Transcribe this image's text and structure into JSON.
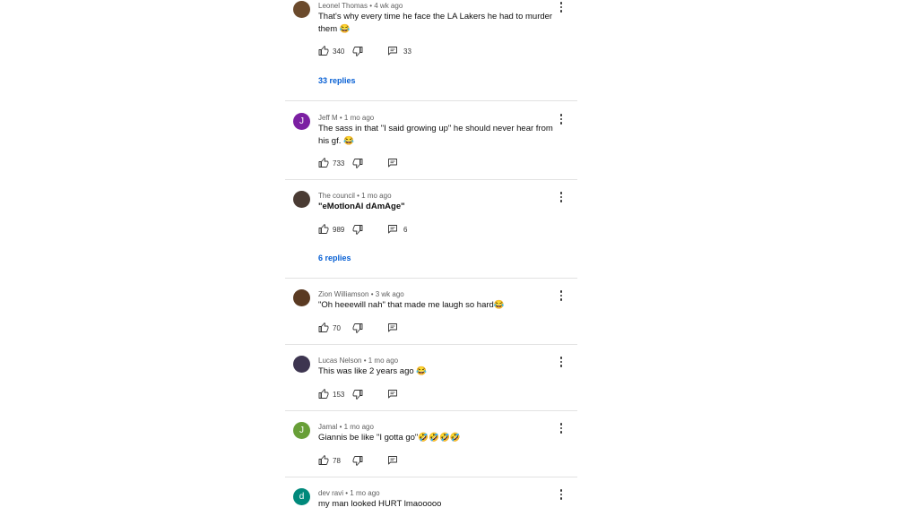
{
  "comments": [
    {
      "author": "Leonel Thomas",
      "time": "4 wk ago",
      "text": "That's why every time he face the LA Lakers he had to murder them 😂",
      "likes": "340",
      "reply_count": "33",
      "replies_label": "33 replies",
      "avatar_letter": "",
      "avatar_color": "#6b4a2c"
    },
    {
      "author": "Jeff M",
      "time": "1 mo ago",
      "text": "The sass in that \"I said growing up\" he should never hear from his gf. 😂",
      "likes": "733",
      "reply_count": "",
      "replies_label": "",
      "avatar_letter": "J",
      "avatar_color": "#7b1fa2"
    },
    {
      "author": "The council",
      "time": "1 mo ago",
      "text": "\"eMotIonAl dAmAge\"",
      "likes": "989",
      "reply_count": "6",
      "replies_label": "6 replies",
      "avatar_letter": "",
      "avatar_color": "#4a3b33"
    },
    {
      "author": "Zion Williamson",
      "time": "3 wk ago",
      "text": "\"Oh heeewill nah\" that made me laugh so hard😂",
      "likes": "70",
      "reply_count": "",
      "replies_label": "",
      "avatar_letter": "",
      "avatar_color": "#5a3a22"
    },
    {
      "author": "Lucas Nelson",
      "time": "1 mo ago",
      "text": "This was like 2 years ago 😂",
      "likes": "153",
      "reply_count": "",
      "replies_label": "",
      "avatar_letter": "",
      "avatar_color": "#3d3550"
    },
    {
      "author": "Jamal",
      "time": "1 mo ago",
      "text": "Giannis be like \"I gotta go\"🤣🤣🤣🤣",
      "likes": "78",
      "reply_count": "",
      "replies_label": "",
      "avatar_letter": "J",
      "avatar_color": "#689f38"
    },
    {
      "author": "dev ravi",
      "time": "1 mo ago",
      "text": "my man looked HURT lmaooooo",
      "likes": "",
      "reply_count": "",
      "replies_label": "",
      "avatar_letter": "d",
      "avatar_color": "#00897b"
    }
  ],
  "separator": " • ",
  "icons": {
    "like": "thumb-up-icon",
    "dislike": "thumb-down-icon",
    "reply": "comment-icon",
    "more": "more-vert-icon"
  }
}
